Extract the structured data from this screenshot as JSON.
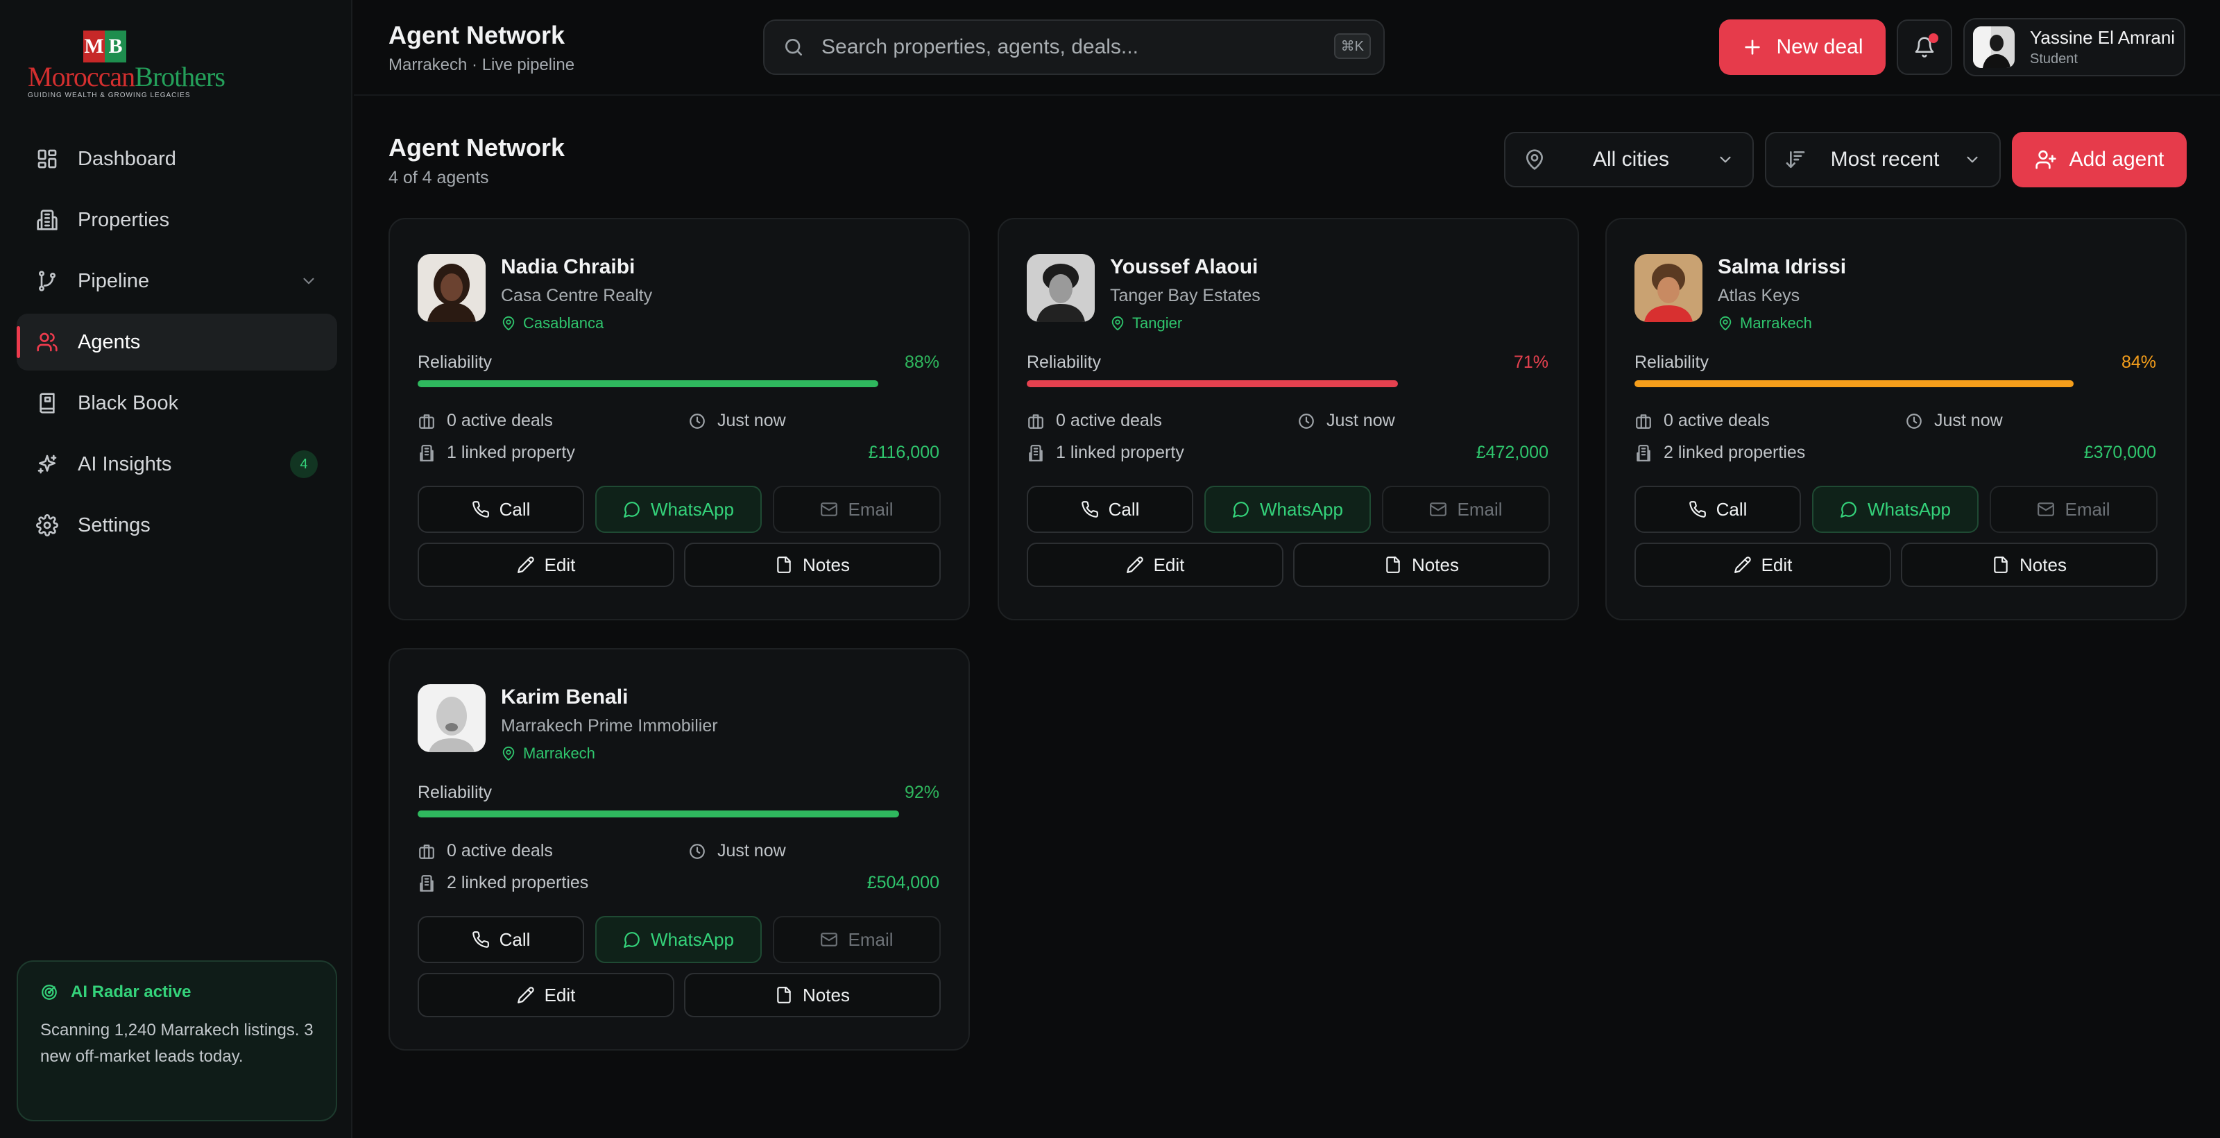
{
  "brand": {
    "logo_m": "M",
    "logo_b": "B",
    "logo_word1": "Moroccan",
    "logo_word2": "Brothers",
    "tagline": "GUIDING WEALTH & GROWING LEGACIES"
  },
  "sidebar": {
    "items": [
      {
        "label": "Dashboard",
        "icon": "grid-icon"
      },
      {
        "label": "Properties",
        "icon": "building-icon"
      },
      {
        "label": "Pipeline",
        "icon": "git-branch-icon"
      },
      {
        "label": "Agents",
        "icon": "users-icon",
        "active": true
      },
      {
        "label": "Black Book",
        "icon": "book-icon"
      },
      {
        "label": "AI Insights",
        "icon": "sparkles-icon",
        "badge": "4"
      },
      {
        "label": "Settings",
        "icon": "gear-icon"
      }
    ],
    "radar": {
      "title": "AI Radar active",
      "text": "Scanning 1,240 Marrakech listings. 3 new off-market leads today."
    }
  },
  "topbar": {
    "title": "Agent Network",
    "subtitle": "Marrakech · Live pipeline",
    "search_placeholder": "Search properties, agents, deals...",
    "shortcut": "⌘K",
    "new_deal": "New deal",
    "user_name": "Yassine El Amrani",
    "user_role": "Student"
  },
  "page": {
    "title": "Agent Network",
    "count": "4 of 4 agents",
    "city_filter": "All cities",
    "sort": "Most recent",
    "add_agent": "Add agent"
  },
  "labels": {
    "reliability": "Reliability",
    "call": "Call",
    "whatsapp": "WhatsApp",
    "email": "Email",
    "edit": "Edit",
    "notes": "Notes"
  },
  "colors": {
    "accent": "#e63b4b",
    "green": "#2fc56d",
    "red": "#e5414f",
    "orange": "#f59e1b"
  },
  "agents": [
    {
      "name": "Nadia Chraibi",
      "agency": "Casa Centre Realty",
      "city": "Casablanca",
      "reliability": 88,
      "reliability_label": "88%",
      "color": "#2fb85e",
      "active_deals": "0 active deals",
      "last_seen": "Just now",
      "linked": "1 linked property",
      "value": "£116,000"
    },
    {
      "name": "Youssef Alaoui",
      "agency": "Tanger Bay Estates",
      "city": "Tangier",
      "reliability": 71,
      "reliability_label": "71%",
      "color": "#e5414f",
      "active_deals": "0 active deals",
      "last_seen": "Just now",
      "linked": "1 linked property",
      "value": "£472,000"
    },
    {
      "name": "Salma Idrissi",
      "agency": "Atlas Keys",
      "city": "Marrakech",
      "reliability": 84,
      "reliability_label": "84%",
      "color": "#f59e1b",
      "active_deals": "0 active deals",
      "last_seen": "Just now",
      "linked": "2 linked properties",
      "value": "£370,000"
    },
    {
      "name": "Karim Benali",
      "agency": "Marrakech Prime Immobilier",
      "city": "Marrakech",
      "reliability": 92,
      "reliability_label": "92%",
      "color": "#2fb85e",
      "active_deals": "0 active deals",
      "last_seen": "Just now",
      "linked": "2 linked properties",
      "value": "£504,000"
    }
  ]
}
